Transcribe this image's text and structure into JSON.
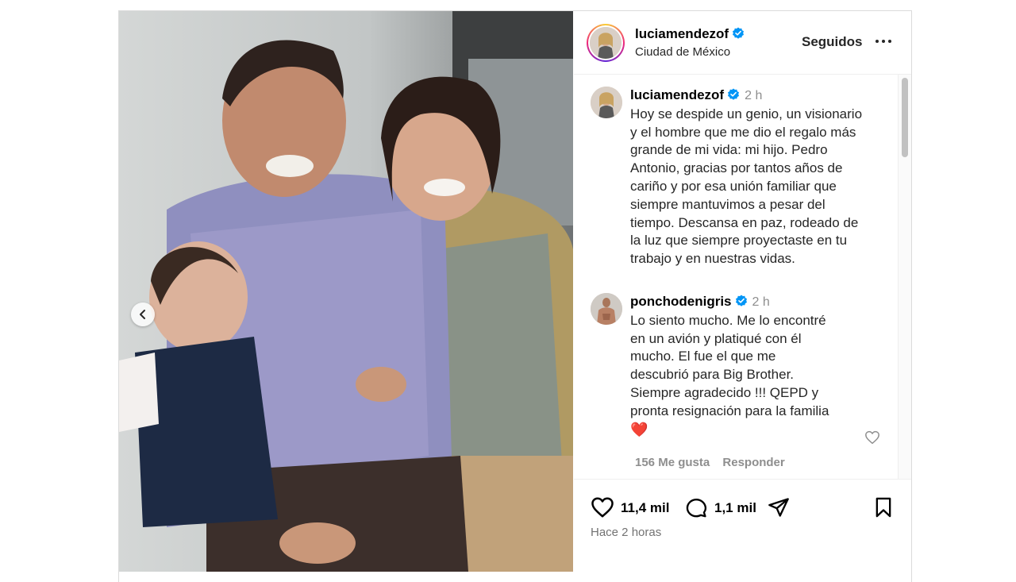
{
  "post": {
    "author": "luciamendezof",
    "location": "Ciudad de México",
    "follow_label": "Seguidos"
  },
  "caption": {
    "username": "luciamendezof",
    "time": "2 h",
    "lines": [
      "Hoy se despide un genio, un visionario",
      "y el hombre que me dio el regalo más",
      "grande de mi vida: mi hijo. Pedro",
      "Antonio, gracias por tantos años de",
      "cariño y por esa unión familiar que",
      "siempre mantuvimos a pesar del",
      "tiempo. Descansa en paz, rodeado de",
      "la luz que siempre proyectaste en tu",
      "trabajo y en nuestras vidas."
    ]
  },
  "comment": {
    "username": "ponchodenigris",
    "time": "2 h",
    "lines": [
      "Lo siento mucho. Me lo encontré",
      "en un avión y platiqué con él",
      "mucho. El fue el que me",
      "descubrió para Big Brother.",
      "Siempre agradecido !!! QEPD y",
      "pronta resignación para la familia"
    ],
    "emoji": "❤️",
    "likes": "156 Me gusta",
    "reply_label": "Responder"
  },
  "actions": {
    "likes": "11,4 mil",
    "comments": "1,1 mil",
    "timestamp": "Hace 2 horas"
  },
  "colors": {
    "verified": "#0095f6",
    "text": "#262626",
    "muted": "#8e8e8e",
    "heart": "#e0112b"
  },
  "icons": {
    "verified": "verified-badge-icon",
    "more": "more-options-icon",
    "like": "heart-icon",
    "comment": "comment-bubble-icon",
    "share": "send-icon",
    "save": "bookmark-icon",
    "carousel_prev": "chevron-left-icon"
  }
}
